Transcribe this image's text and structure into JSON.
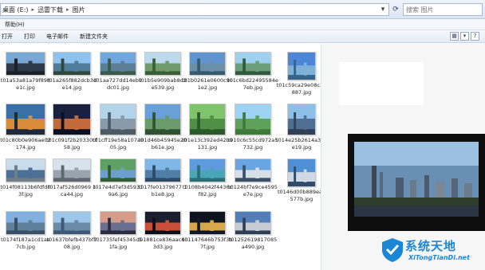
{
  "addressbar": {
    "crumbs": [
      "桌面 (E:)",
      "迅雷下载",
      "图片"
    ],
    "search_placeholder": "搜索 图片"
  },
  "menubar": {
    "help_label": "帮助(H)"
  },
  "toolbar": {
    "buttons": [
      "打开",
      "打印",
      "电子邮件",
      "新建文件夹"
    ]
  },
  "files": [
    {
      "name": "t01a53a81a79f898e1c.jpg",
      "thumb_colors": [
        "#7aa8d6",
        "#2d3a4a",
        "#1a1f29"
      ]
    },
    {
      "name": "t01a265f882dcb3de14.jpg",
      "thumb_colors": [
        "#8ec3ef",
        "#4f7c9a",
        "#2f4a3a"
      ]
    },
    {
      "name": "t01aa727dd14eb9dc01.jpg",
      "thumb_colors": [
        "#6fa7de",
        "#5a7f96",
        "#3b5a4b"
      ]
    },
    {
      "name": "t01b5e909bab8d3e539.jpg",
      "thumb_colors": [
        "#bcd9ee",
        "#6f9c6a",
        "#3a5f37"
      ]
    },
    {
      "name": "t01b0261e0600c901e2.jpg",
      "thumb_colors": [
        "#5f94d1",
        "#6a8fa8",
        "#355a6e"
      ]
    },
    {
      "name": "t01c6bd22495584e7eb.jpg",
      "thumb_colors": [
        "#9fd1ef",
        "#6c9e7c",
        "#2f5a3c"
      ]
    },
    {
      "name": "t01c59ca29e08c33887.jpg",
      "thumb_colors": [
        "#4d86d6",
        "#7fb0d8",
        "#37648a"
      ]
    },
    {
      "name": "t01c80b0e906ae02174.jpg",
      "thumb_colors": [
        "#3b6fa8",
        "#d98b3a",
        "#1c2a3b"
      ]
    },
    {
      "name": "t01c091f2b20330cf58.jpg",
      "thumb_colors": [
        "#1a2040",
        "#c26a3b",
        "#0c1020"
      ]
    },
    {
      "name": "t01cff19e58a107a005.jpg",
      "thumb_colors": [
        "#b3d3ea",
        "#8a9aa8",
        "#4c5a64"
      ]
    },
    {
      "name": "t01d46b45945e20b61e.jpg",
      "thumb_colors": [
        "#6aa0d9",
        "#6b9a6c",
        "#2e5131"
      ]
    },
    {
      "name": "t01e13c392ed42b9131.jpg",
      "thumb_colors": [
        "#7fc46a",
        "#4f8f46",
        "#2b5a2a"
      ]
    },
    {
      "name": "t010c6c55cd972a5732.jpg",
      "thumb_colors": [
        "#9dd3f2",
        "#5fa05b",
        "#3f7a3a"
      ]
    },
    {
      "name": "t014e25b2614a3c5e19.jpg",
      "thumb_colors": [
        "#8cbfe8",
        "#4f6f92",
        "#2f4058"
      ]
    },
    {
      "name": "t014f08113b6fdfd03f.jpg",
      "thumb_colors": [
        "#c8dcec",
        "#4b6f95",
        "#6f7f8a"
      ]
    },
    {
      "name": "t017af526d0969 1ca44.jpg",
      "thumb_colors": [
        "#d8e2ea",
        "#9aa4ad",
        "#5f6870"
      ]
    },
    {
      "name": "t017e4d7ef3d59319a6.jpg",
      "thumb_colors": [
        "#5fa065",
        "#6c9fcd",
        "#2f5c34"
      ]
    },
    {
      "name": "t017fe01379677 1b1e8.jpg",
      "thumb_colors": [
        "#7fb7e6",
        "#4f7fa6",
        "#2d4a66"
      ]
    },
    {
      "name": "t0108b4042f4436cf82.jpg",
      "thumb_colors": [
        "#5f9adf",
        "#4aa6b6",
        "#2a6e7a"
      ]
    },
    {
      "name": "t0124bf7e9ce4595e7e.jpg",
      "thumb_colors": [
        "#6aa5e3",
        "#d9dfe6",
        "#3b4f66"
      ]
    },
    {
      "name": "t0146d00b889eae577b.jpg",
      "thumb_colors": [
        "#4f8fd6",
        "#cfd9e3",
        "#2f4a6a"
      ]
    },
    {
      "name": "t0174f187a1cd1ae7cb.jpg",
      "thumb_colors": [
        "#7fb0e0",
        "#5f7f9a",
        "#3a5066"
      ]
    },
    {
      "name": "t01637bfefb437bf708.jpg",
      "thumb_colors": [
        "#9ec7ea",
        "#6b8aa8",
        "#3d5a74"
      ]
    },
    {
      "name": "t01735fef45345c51fa.jpg",
      "thumb_colors": [
        "#d79c8a",
        "#6a6f8f",
        "#2a2d3f"
      ]
    },
    {
      "name": "t01881ce836aac603d3.jpg",
      "thumb_colors": [
        "#1a1e2f",
        "#c8503a",
        "#0d0f18"
      ]
    },
    {
      "name": "t01147646b753f3b7f.jpg",
      "thumb_colors": [
        "#0d1420",
        "#d6a84a",
        "#121a2a"
      ]
    },
    {
      "name": "t01252619817085a490.jpg",
      "thumb_colors": [
        "#4f7fb6",
        "#c7ccd4",
        "#2f3f56"
      ]
    }
  ],
  "preview": {
    "frame_caption": ""
  }
}
